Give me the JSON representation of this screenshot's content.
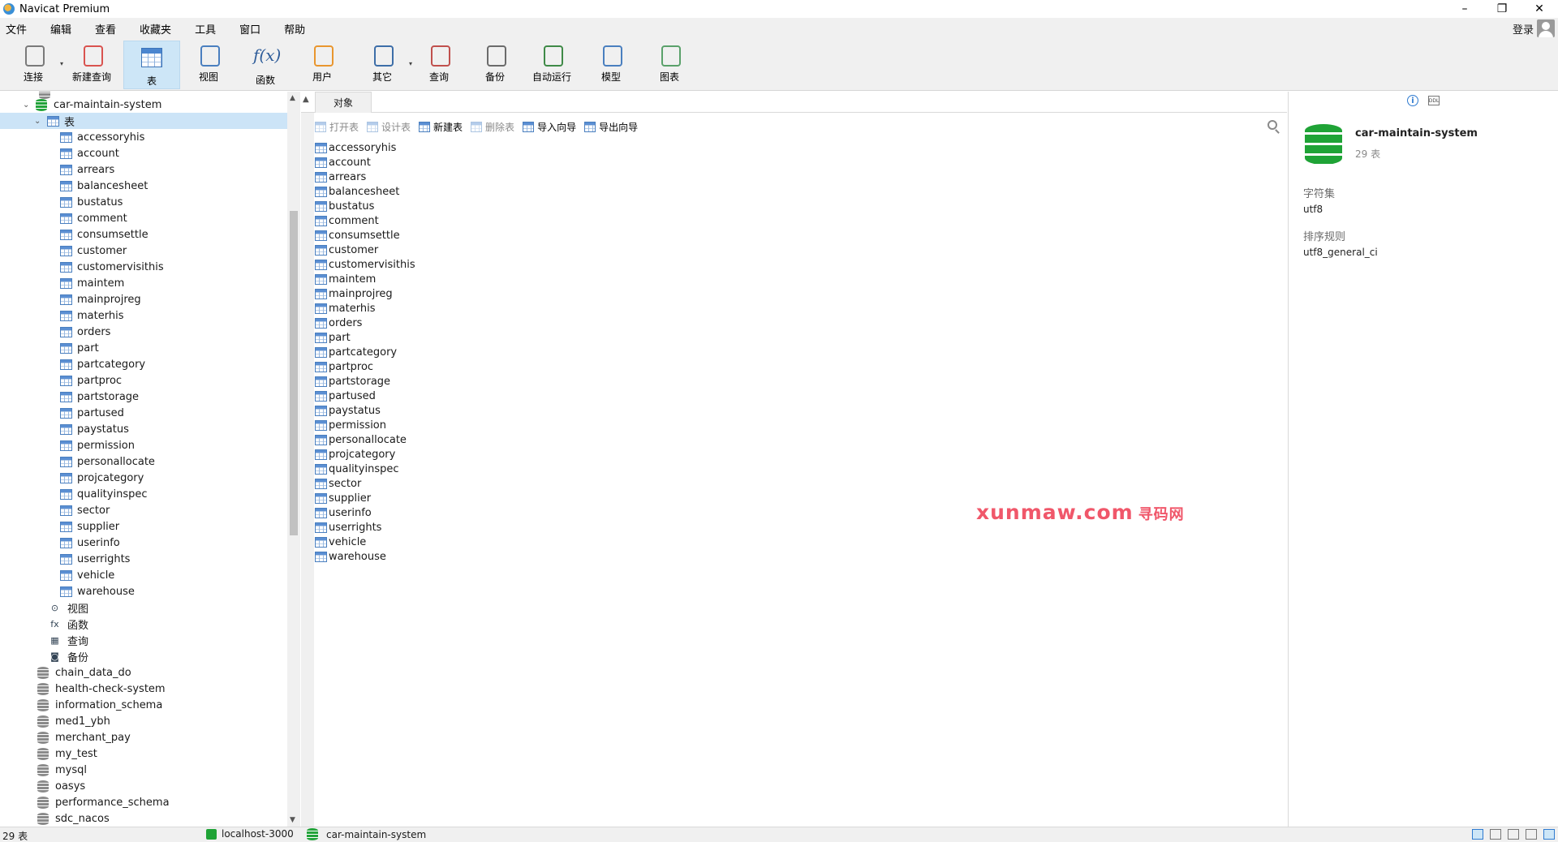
{
  "window": {
    "title": "Navicat Premium",
    "minimize": "–",
    "restore": "❐",
    "close": "✕"
  },
  "menu": [
    "文件",
    "编辑",
    "查看",
    "收藏夹",
    "工具",
    "窗口",
    "帮助"
  ],
  "login_label": "登录",
  "toolbar": [
    {
      "label": "连接",
      "icon": "plug-icon",
      "caret": true
    },
    {
      "label": "新建查询",
      "icon": "new-query-icon"
    },
    {
      "label": "表",
      "icon": "table-icon",
      "active": true
    },
    {
      "label": "视图",
      "icon": "view-icon"
    },
    {
      "label": "函数",
      "icon": "function-icon",
      "glyph": "f(x)"
    },
    {
      "label": "用户",
      "icon": "user-icon"
    },
    {
      "label": "其它",
      "icon": "tools-icon",
      "caret": true
    },
    {
      "label": "查询",
      "icon": "query-icon"
    },
    {
      "label": "备份",
      "icon": "backup-icon"
    },
    {
      "label": "自动运行",
      "icon": "schedule-icon"
    },
    {
      "label": "模型",
      "icon": "model-icon"
    },
    {
      "label": "图表",
      "icon": "chart-icon"
    }
  ],
  "tree": {
    "active_db": "car-maintain-system",
    "tables_node": "表",
    "tables": [
      "accessoryhis",
      "account",
      "arrears",
      "balancesheet",
      "bustatus",
      "comment",
      "consumsettle",
      "customer",
      "customervisithis",
      "maintem",
      "mainprojreg",
      "materhis",
      "orders",
      "part",
      "partcategory",
      "partproc",
      "partstorage",
      "partused",
      "paystatus",
      "permission",
      "personallocate",
      "projcategory",
      "qualityinspec",
      "sector",
      "supplier",
      "userinfo",
      "userrights",
      "vehicle",
      "warehouse"
    ],
    "other_nodes": [
      {
        "label": "视图",
        "icon": "view-icon",
        "glyph": "⊙"
      },
      {
        "label": "函数",
        "icon": "function-icon",
        "glyph": "fx"
      },
      {
        "label": "查询",
        "icon": "query-icon",
        "glyph": "▦"
      },
      {
        "label": "备份",
        "icon": "backup-icon",
        "glyph": "◙"
      }
    ],
    "databases": [
      "chain_data_do",
      "health-check-system",
      "information_schema",
      "med1_ybh",
      "merchant_pay",
      "my_test",
      "mysql",
      "oasys",
      "performance_schema",
      "sdc_nacos"
    ]
  },
  "objects": {
    "tab_label": "对象",
    "actions": [
      {
        "label": "打开表",
        "enabled": false
      },
      {
        "label": "设计表",
        "enabled": false
      },
      {
        "label": "新建表",
        "enabled": true
      },
      {
        "label": "删除表",
        "enabled": false
      },
      {
        "label": "导入向导",
        "enabled": true
      },
      {
        "label": "导出向导",
        "enabled": true
      }
    ],
    "items": [
      "accessoryhis",
      "account",
      "arrears",
      "balancesheet",
      "bustatus",
      "comment",
      "consumsettle",
      "customer",
      "customervisithis",
      "maintem",
      "mainprojreg",
      "materhis",
      "orders",
      "part",
      "partcategory",
      "partproc",
      "partstorage",
      "partused",
      "paystatus",
      "permission",
      "personallocate",
      "projcategory",
      "qualityinspec",
      "sector",
      "supplier",
      "userinfo",
      "userrights",
      "vehicle",
      "warehouse"
    ]
  },
  "watermark": {
    "text": "xunmaw.com",
    "suffix": "寻码网"
  },
  "info": {
    "db_name": "car-maintain-system",
    "table_count": "29 表",
    "charset_label": "字符集",
    "charset_value": "utf8",
    "collation_label": "排序规则",
    "collation_value": "utf8_general_ci"
  },
  "status": {
    "count": "29 表",
    "connection": "localhost-3000",
    "database": "car-maintain-system"
  },
  "colors": {
    "accent": "#2f7bd0",
    "db_green": "#1fa336",
    "selection": "#cce4f7",
    "watermark": "#f0576a"
  }
}
